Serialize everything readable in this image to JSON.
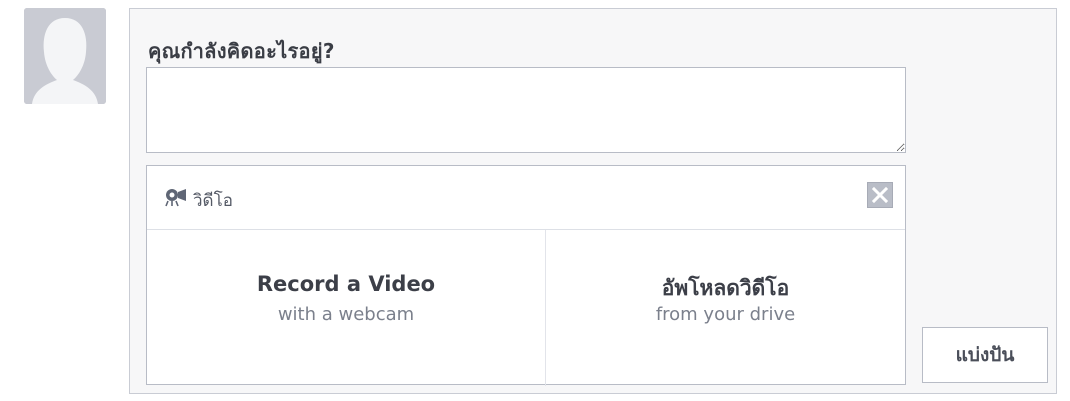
{
  "composer": {
    "prompt": "คุณกำลังคิดอะไรอยู่?",
    "status_value": "",
    "status_placeholder": ""
  },
  "video_panel": {
    "icon": "video-camera-icon",
    "title": "วิดีโอ",
    "close_icon": "close-icon",
    "record": {
      "title": "Record a Video",
      "subtitle": "with a webcam"
    },
    "upload": {
      "title": "อัพโหลดวิดีโอ",
      "subtitle": "from your drive"
    }
  },
  "share_button": {
    "label": "แบ่งปัน"
  },
  "colors": {
    "avatar_bg": "#c9cbd3",
    "panel_border": "#b8bcc6",
    "close_bg": "#b9bdc7"
  }
}
